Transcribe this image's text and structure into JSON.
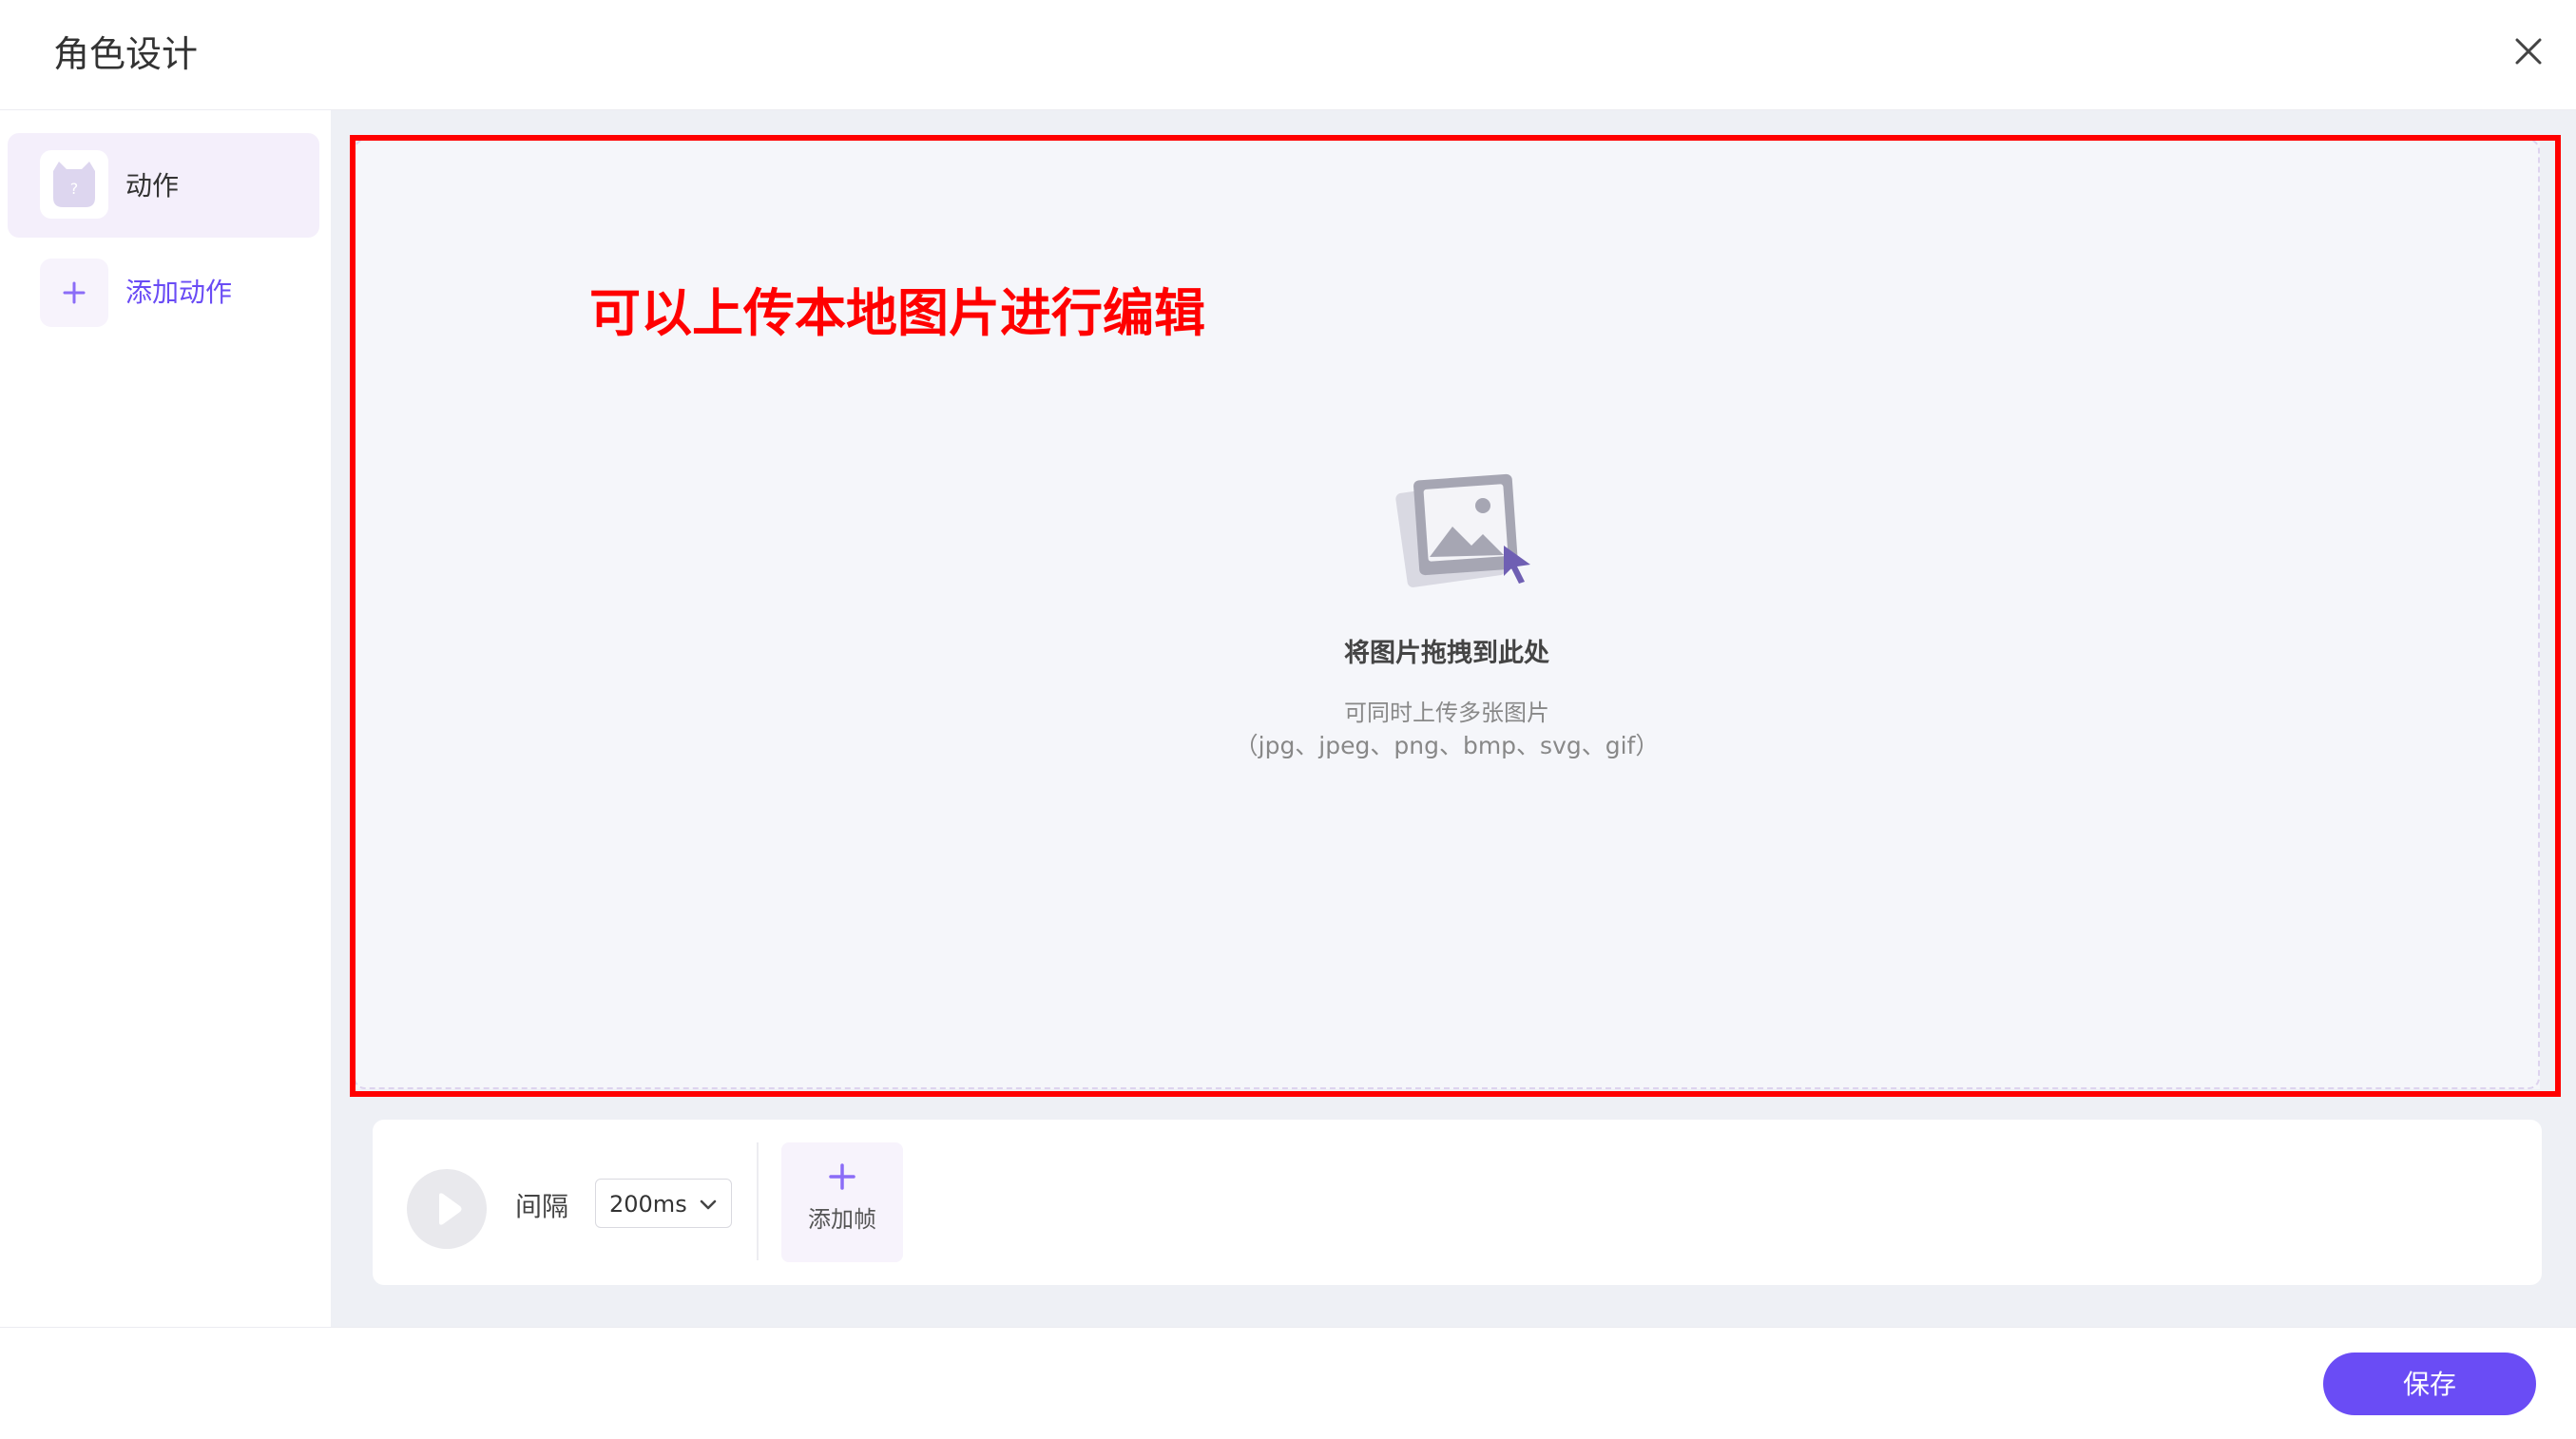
{
  "dialog": {
    "title": "角色设计",
    "close_icon": "close-icon"
  },
  "sidebar": {
    "items": [
      {
        "label": "动作",
        "icon": "cat-avatar-icon"
      }
    ],
    "add_action": {
      "label": "添加动作",
      "icon": "plus-icon"
    }
  },
  "annotation": {
    "text": "可以上传本地图片进行编辑",
    "color": "#ff0000"
  },
  "upload": {
    "icon": "image-upload-icon",
    "title": "将图片拖拽到此处",
    "subtitle": "可同时上传多张图片",
    "formats": "（jpg、jpeg、png、bmp、svg、gif）"
  },
  "timeline": {
    "play_icon": "play-icon",
    "interval_label": "间隔",
    "interval_value": "200ms",
    "interval_icon": "chevron-down-icon",
    "add_frame": {
      "label": "添加帧",
      "icon": "plus-icon"
    }
  },
  "footer": {
    "save_label": "保存"
  },
  "colors": {
    "accent": "#6a4cf5",
    "panel_bg": "#eef0f5",
    "active_item_bg": "#f4effb"
  }
}
